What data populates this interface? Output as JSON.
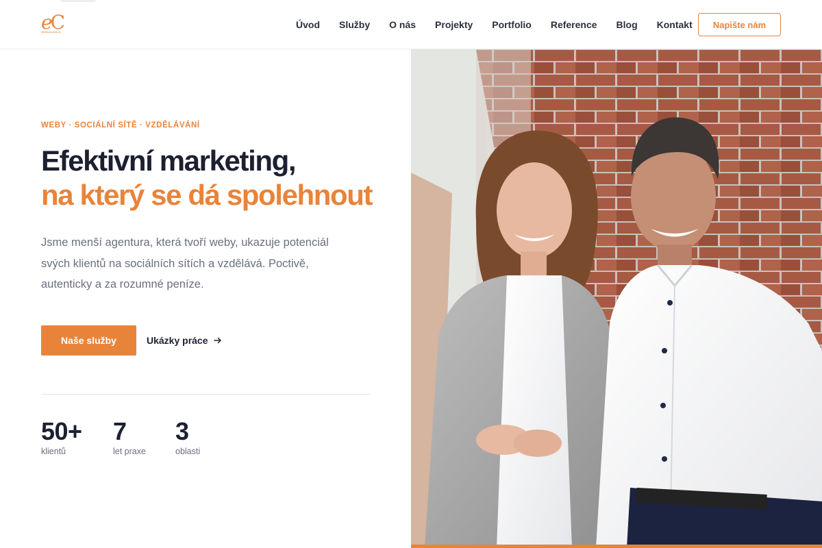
{
  "logo": {
    "mark_e": "e",
    "mark_c": "C",
    "sub": "efektivnicesta.cz"
  },
  "nav": {
    "items": [
      "Úvod",
      "Služby",
      "O nás",
      "Projekty",
      "Portfolio",
      "Reference",
      "Blog",
      "Kontakt"
    ],
    "cta": "Napište nám"
  },
  "hero": {
    "eyebrow": "WEBY · SOCIÁLNÍ SÍTĚ · VZDĚLÁVÁNÍ",
    "title_line1": "Efektivní marketing,",
    "title_line2": "na který se dá spolehnout",
    "lead": "Jsme menší agentura, která tvoří weby, ukazuje potenciál svých klientů na sociálních sítích a vzdělává. Poctivě, autenticky a za rozumné peníze.",
    "primary_button": "Naše služby",
    "secondary_link": "Ukázky práce"
  },
  "stats": [
    {
      "value": "50+",
      "label": "klientů"
    },
    {
      "value": "7",
      "label": "let praxe"
    },
    {
      "value": "3",
      "label": "oblasti"
    }
  ],
  "colors": {
    "accent": "#e8843a",
    "text": "#1c2030",
    "muted": "#6a6f7e"
  },
  "icons": {
    "arrow": "arrow-right-icon"
  }
}
